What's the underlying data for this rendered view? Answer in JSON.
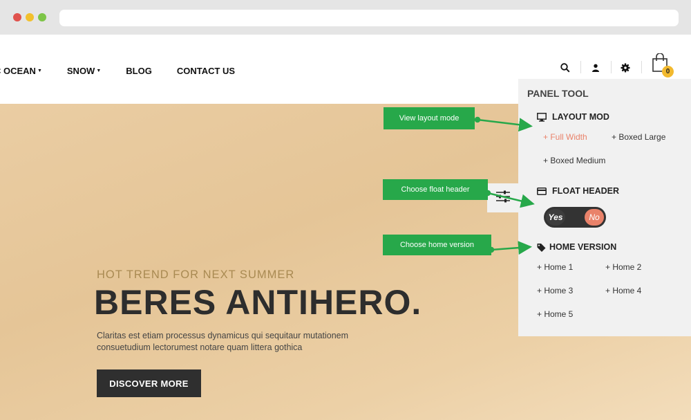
{
  "browser": {
    "window_controls": [
      "close",
      "minimize",
      "maximize"
    ]
  },
  "nav": {
    "items": [
      {
        "label": "C OCEAN",
        "has_dropdown": true
      },
      {
        "label": "SNOW",
        "has_dropdown": true
      },
      {
        "label": "BLOG",
        "has_dropdown": false
      },
      {
        "label": "CONTACT US",
        "has_dropdown": false
      }
    ],
    "icons": [
      "search-icon",
      "user-icon",
      "gear-icon",
      "shopping-bag-icon"
    ],
    "cart_count": "0"
  },
  "hero": {
    "subtitle": "HOT TREND FOR NEXT SUMMER",
    "title": "BERES ANTIHERO.",
    "description_line1": "Claritas est etiam processus dynamicus qui sequitaur mutationem",
    "description_line2": "consuetudium lectorumest notare quam littera gothica",
    "button_label": "DISCOVER MORE"
  },
  "panel": {
    "title": "PANEL TOOL",
    "layout": {
      "heading": "LAYOUT MOD",
      "options": [
        "+ Full Width",
        "+ Boxed Large",
        "+ Boxed Medium"
      ],
      "active": "+ Full Width"
    },
    "float_header": {
      "heading": "FLOAT HEADER",
      "yes_label": "Yes",
      "no_label": "No",
      "selected": "No"
    },
    "home": {
      "heading": "HOME VERSION",
      "options": [
        "+ Home 1",
        "+ Home 2",
        "+ Home 3",
        "+ Home 4",
        "+ Home 5"
      ]
    }
  },
  "callouts": {
    "layout": "View layout mode",
    "float": "Choose float header",
    "home": "Choose home version"
  },
  "colors": {
    "accent": "#e9826a",
    "callout": "#27a84a",
    "badge": "#f2b92e",
    "hero_bg": "#e8ca9e",
    "button_dark": "#2f2f2f"
  }
}
